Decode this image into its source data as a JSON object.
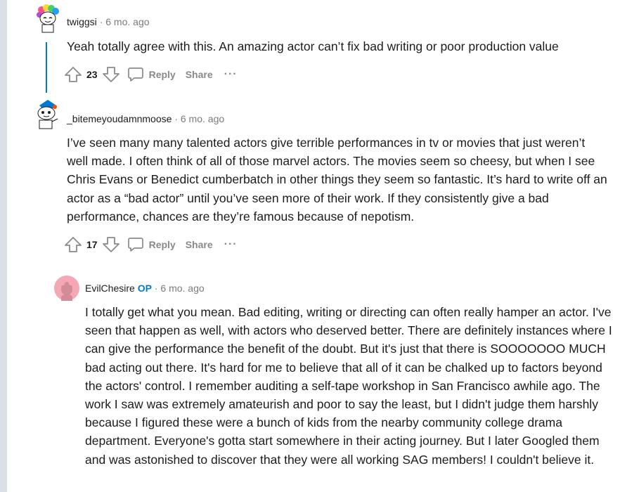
{
  "comments": [
    {
      "username": "twiggsi",
      "separator": "·",
      "time": "6 mo. ago",
      "text": "Yeah totally agree with this. An amazing actor can’t fix bad writing or poor production value",
      "votes": "23",
      "reply_label": "Reply",
      "share_label": "Share",
      "more_label": "···"
    },
    {
      "username": "_bitemeyoudamnmoose",
      "separator": "·",
      "time": "6 mo. ago",
      "text": "I’ve seen many many talented actors give terrible performances in tv or movies that just weren’t well made. I often think of all of those marvel actors. The movies seem so cheesy, but when I see Chris Evans or Benedict cumberbatch in other things they seem so fantastic. It’s hard to write off an actor as a “bad actor” until you’ve seen more of their work. If they consistently give a bad performance, chances are they’re famous because of nepotism.",
      "votes": "17",
      "reply_label": "Reply",
      "share_label": "Share",
      "more_label": "···"
    },
    {
      "username": "EvilChesire",
      "op_badge": "OP",
      "separator": "·",
      "time": "6 mo. ago",
      "text": "I totally get what you mean. Bad editing, writing or directing can often really hamper an actor. I've seen that happen as well, with actors who deserved better. There are definitely instances where I can give the performance the benefit of the doubt. But it's just that there is SOOOOOOO MUCH bad acting out there. It's hard for me to believe that all of it can be chalked up to factors beyond the actors' control. I remember auditing a self-tape workshop in San Francisco awhile ago. The work I saw was extremely amateurish and poor to say the least, but I didn't judge them harshly because I figured these were a bunch of kids from the nearby community college drama department. Everyone's gotta start somewhere in their acting journey. But I later Googled them and was astonished to discover that they were all working SAG members! I couldn't believe it."
    }
  ],
  "colors": {
    "thread_line": "#0079d3",
    "op_badge": "#0079d3",
    "muted": "#878a8c",
    "rail": "#dae0e6"
  },
  "icons": [
    "upvote-icon",
    "downvote-icon",
    "comment-bubble-icon",
    "more-options-icon",
    "snoo-avatar-icon"
  ]
}
